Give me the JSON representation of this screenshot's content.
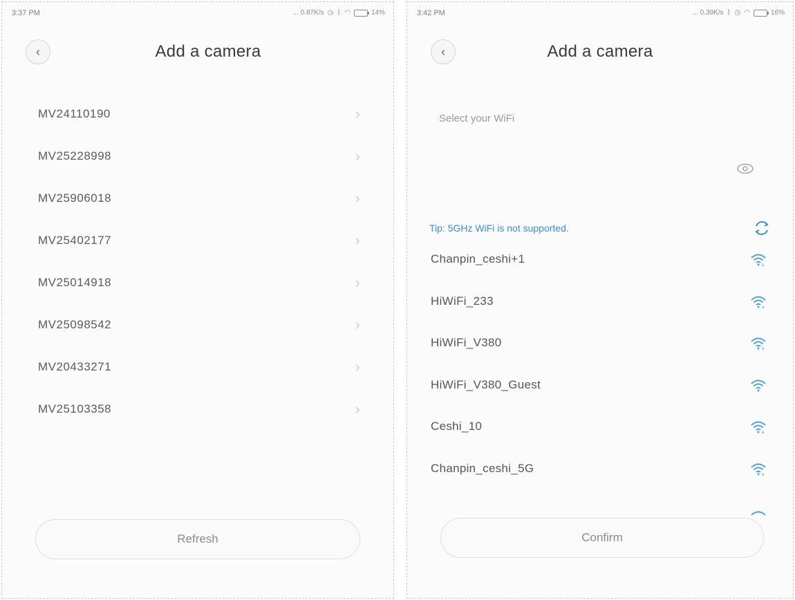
{
  "left_screen": {
    "status": {
      "time": "3:37 PM",
      "network": "... 0.87K/s",
      "battery": "14%"
    },
    "title": "Add a camera",
    "devices": [
      "MV24110190",
      "MV25228998",
      "MV25906018",
      "MV25402177",
      "MV25014918",
      "MV25098542",
      "MV20433271",
      "MV25103358"
    ],
    "refresh_label": "Refresh"
  },
  "right_screen": {
    "status": {
      "time": "3:42 PM",
      "network": "... 0.39K/s",
      "battery": "16%"
    },
    "title": "Add a camera",
    "wifi_label": "Select your WiFi",
    "tip": "Tip: 5GHz WiFi is not supported.",
    "networks": [
      "Chanpin_ceshi+1",
      "HiWiFi_233",
      "HiWiFi_V380",
      "HiWiFi_V380_Guest",
      "Ceshi_10",
      "Chanpin_ceshi_5G"
    ],
    "confirm_label": "Confirm"
  },
  "icons": {
    "back": "chevron-left-icon",
    "row_chevron": "chevron-right-icon",
    "password_visibility": "eye-icon",
    "refresh": "refresh-icon",
    "wifi_signal": "wifi-signal-icon"
  },
  "colors": {
    "accent_blue": "#3a8bd6",
    "wifi_icon": "#4aa3d8",
    "text": "#555555"
  }
}
